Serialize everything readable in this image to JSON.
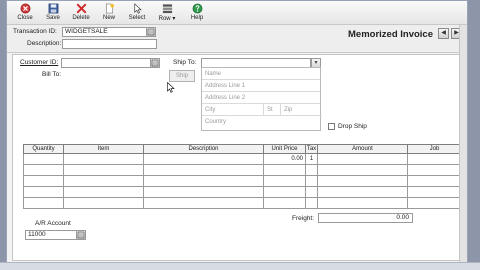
{
  "toolbar": {
    "buttons": [
      {
        "label": "Close",
        "icon": "close-icon"
      },
      {
        "label": "Save",
        "icon": "save-icon"
      },
      {
        "label": "Delete",
        "icon": "delete-icon"
      },
      {
        "label": "New",
        "icon": "new-icon"
      },
      {
        "label": "Select",
        "icon": "select-icon"
      },
      {
        "label": "Row",
        "icon": "row-icon"
      },
      {
        "label": "Help",
        "icon": "help-icon"
      }
    ]
  },
  "header": {
    "transaction_id_label": "Transaction ID:",
    "transaction_id_value": "WIDGETSALE",
    "description_label": "Description:",
    "description_value": "",
    "title": "Memorized Invoice"
  },
  "form": {
    "customer_id_label": "Customer ID:",
    "customer_id_value": "",
    "bill_to_label": "Bill To:",
    "ship_to_label": "Ship To:",
    "ship_to_value": "",
    "ship_button_label": "Ship",
    "address": {
      "name_placeholder": "Name",
      "line1_placeholder": "Address Line 1",
      "line2_placeholder": "Address Line 2",
      "city_placeholder": "City",
      "state_placeholder": "St",
      "zip_placeholder": "Zip",
      "country_placeholder": "Country"
    },
    "drop_ship_label": "Drop Ship"
  },
  "grid": {
    "columns": [
      "Quantity",
      "Item",
      "Description",
      "Unit Price",
      "Tax",
      "Amount",
      "Job"
    ],
    "first_row": {
      "unit_price": "0.00",
      "tax": "1"
    }
  },
  "totals": {
    "freight_label": "Freight:",
    "freight_value": "0.00"
  },
  "ar_account": {
    "label": "A/R Account",
    "value": "11000"
  },
  "colors": {
    "window_bg": "#f3f3f3",
    "form_bg": "#ffffff",
    "desktop_bg": "#8c96a8"
  }
}
